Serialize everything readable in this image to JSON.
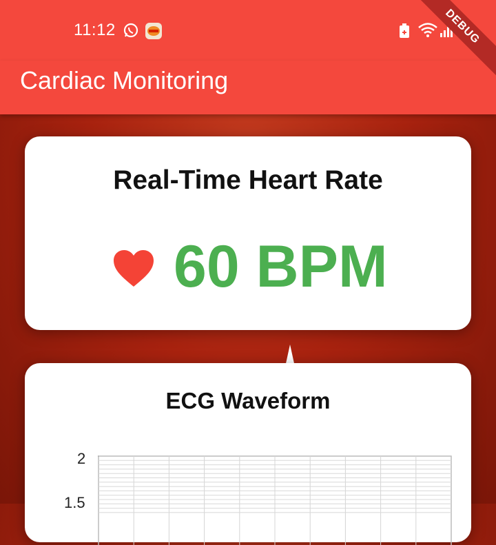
{
  "status_bar": {
    "time": "11:12",
    "left_icons": [
      "whatsapp-icon",
      "burger-king-icon"
    ],
    "right_icons": [
      "battery-saver-icon",
      "wifi-icon",
      "signal-icon",
      "battery-icon"
    ]
  },
  "debug_banner": "DEBUG",
  "app_bar": {
    "title": "Cardiac Monitoring"
  },
  "heart_rate_card": {
    "title": "Real-Time Heart Rate",
    "icon": "heart-icon",
    "value": "60 BPM",
    "value_color": "#4caf50",
    "icon_color": "#f44336"
  },
  "ecg_card": {
    "title": "ECG Waveform",
    "chart_data": {
      "type": "line",
      "yticks": [
        "2",
        "1.5"
      ],
      "grid": true
    }
  },
  "colors": {
    "app_bar": "#f4483d",
    "background": "#a8220f",
    "card": "#ffffff"
  }
}
